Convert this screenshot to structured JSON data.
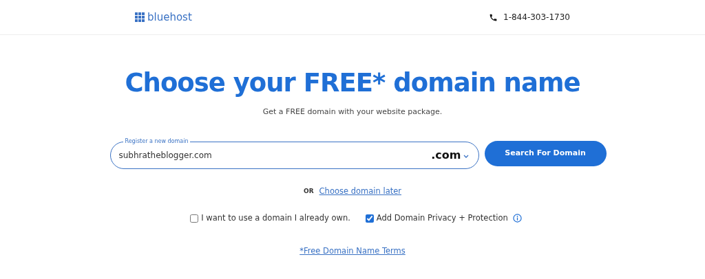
{
  "header": {
    "logo": "bluehost",
    "phone": "1-844-303-1730"
  },
  "title": "Choose your FREE* domain name",
  "subtitle": "Get a FREE domain with your website package.",
  "domain_field": {
    "label": "Register a new domain",
    "value": "subhratheblogger.com",
    "extension": ".com"
  },
  "search_button": "Search For Domain",
  "or_text": "OR",
  "later_link": "Choose domain later",
  "options": [
    {
      "label": "I want to use a domain I already own.",
      "checked": false,
      "info": false
    },
    {
      "label": "Add Domain Privacy + Protection",
      "checked": true,
      "info": true
    }
  ],
  "terms_link": "*Free Domain Name Terms"
}
